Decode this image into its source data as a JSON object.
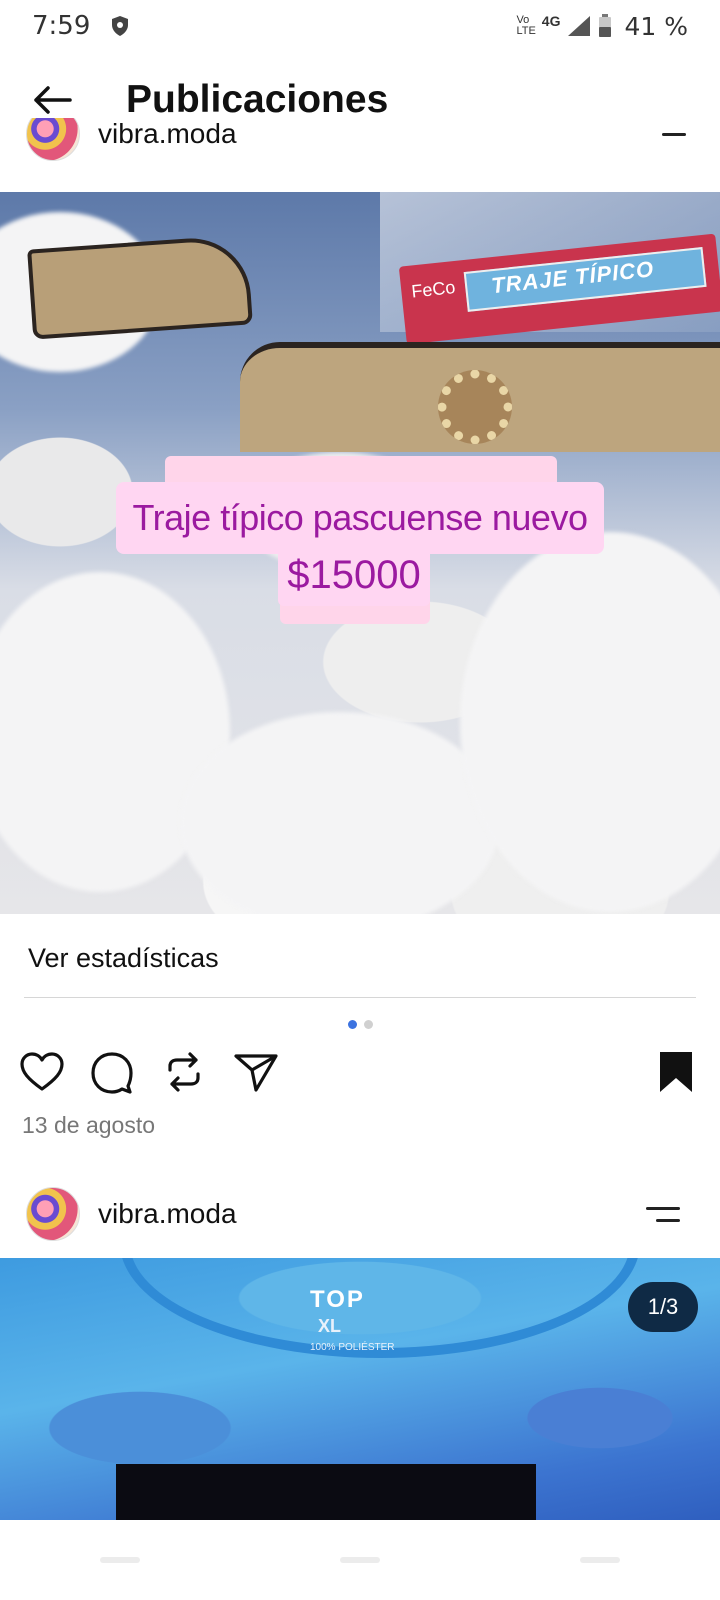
{
  "status_bar": {
    "time": "7:59",
    "volte_top": "Vo",
    "volte_bottom": "LTE",
    "network": "4G",
    "battery": "41 %"
  },
  "header": {
    "title": "Publicaciones",
    "back_icon": "arrow-left-icon"
  },
  "post1": {
    "username": "vibra.moda",
    "image": {
      "package_brand": "FeCo",
      "package_label": "TRAJE TÍPICO",
      "caption_line1": "Traje típico pascuense nuevo",
      "caption_line2": "$15000"
    },
    "stats_link": "Ver estadísticas",
    "carousel_dots": 2,
    "active_dot": 0,
    "actions": [
      "heart-icon",
      "comment-icon",
      "repost-icon",
      "share-icon",
      "bookmark-icon"
    ],
    "date": "13 de agosto"
  },
  "post2": {
    "username": "vibra.moda",
    "counter": "1/3",
    "image": {
      "tag_brand": "TOP",
      "tag_size": "XL",
      "tag_fabric": "100% POLIÉSTER"
    }
  },
  "colors": {
    "accent_dot": "#3c73e0",
    "caption_text": "#9b1aa0",
    "caption_bg": "#ffd6f2"
  }
}
